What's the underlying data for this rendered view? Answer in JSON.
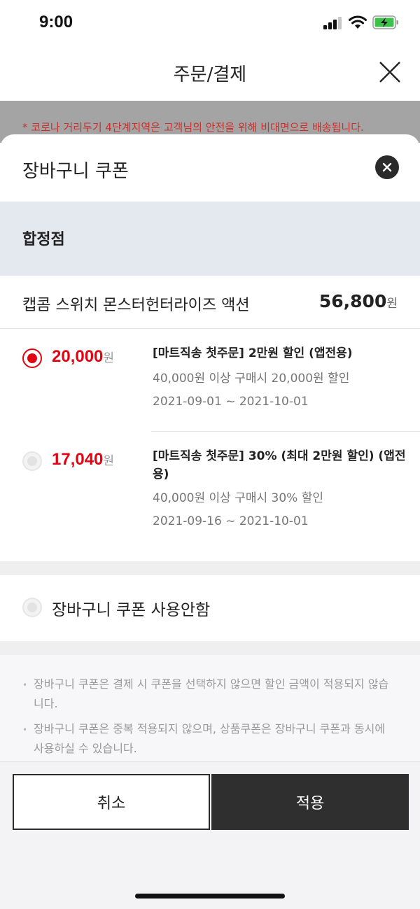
{
  "status": {
    "time": "9:00"
  },
  "header": {
    "title": "주문/결제"
  },
  "notice": "* 코로나 거리두기 4단계지역은 고객님의 안전을 위해 비대면으로 배송됩니다.",
  "sheet": {
    "title": "장바구니 쿠폰",
    "store": "합정점",
    "product": {
      "name": "캡콤 스위치 몬스터헌터라이즈 액션",
      "price": "56,800",
      "currency": "원"
    },
    "coupons": [
      {
        "selected": true,
        "amount": "20,000",
        "currency": "원",
        "title": "[마트직송 첫주문] 2만원 할인 (앱전용)",
        "condition": "40,000원 이상 구매시 20,000원 할인",
        "period": "2021-09-01 ~ 2021-10-01"
      },
      {
        "selected": false,
        "amount": "17,040",
        "currency": "원",
        "title": "[마트직송 첫주문] 30% (최대 2만원 할인) (앱전용)",
        "condition": "40,000원 이상 구매시 30% 할인",
        "period": "2021-09-16 ~ 2021-10-01"
      }
    ],
    "no_coupon_label": "장바구니 쿠폰 사용안함",
    "notes": [
      "장바구니 쿠폰은 결제 시 쿠폰을 선택하지 않으면 할인 금액이 적용되지 않습니다.",
      "장바구니 쿠폰은 중복 적용되지 않으며, 상품쿠폰은 장바구니 쿠폰과 동시에 사용하실 수 있습니다."
    ]
  },
  "buttons": {
    "cancel": "취소",
    "apply": "적용"
  },
  "colors": {
    "accent": "#e10514",
    "dark": "#2f2f2f",
    "store_band": "#e4e9f0"
  }
}
